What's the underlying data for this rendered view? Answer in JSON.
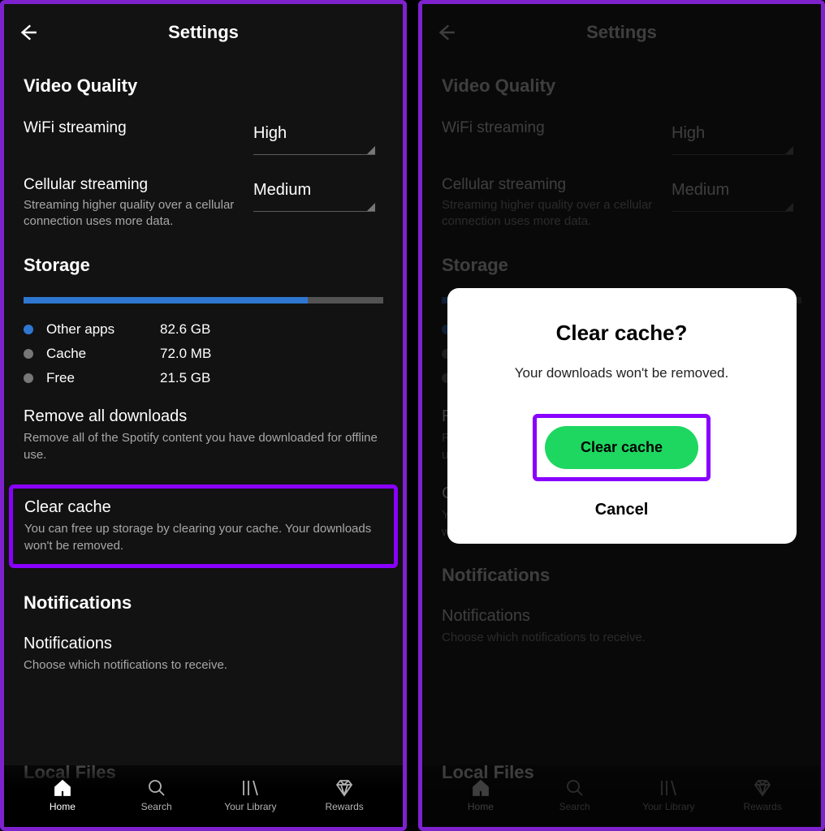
{
  "header": {
    "title": "Settings"
  },
  "video": {
    "section_title": "Video Quality",
    "wifi_label": "WiFi streaming",
    "wifi_value": "High",
    "cell_label": "Cellular streaming",
    "cell_sub": "Streaming higher quality over a cellular connection uses more data.",
    "cell_value": "Medium"
  },
  "storage": {
    "section_title": "Storage",
    "bar_used_pct": 79,
    "legend": {
      "other_label": "Other apps",
      "other_val": "82.6 GB",
      "cache_label": "Cache",
      "cache_val": "72.0 MB",
      "free_label": "Free",
      "free_val": "21.5 GB"
    },
    "remove": {
      "title": "Remove all downloads",
      "sub": "Remove all of the Spotify content you have downloaded for offline use."
    },
    "clear": {
      "title": "Clear cache",
      "sub": "You can free up storage by clearing your cache. Your downloads won't be removed."
    }
  },
  "notifications": {
    "section_title": "Notifications",
    "item_title": "Notifications",
    "item_sub": "Choose which notifications to receive."
  },
  "local_files_hint": "Local Files",
  "tabs": {
    "home": "Home",
    "search": "Search",
    "library": "Your Library",
    "rewards": "Rewards"
  },
  "dialog": {
    "title": "Clear cache?",
    "message": "Your downloads won't be removed.",
    "confirm": "Clear cache",
    "cancel": "Cancel"
  }
}
